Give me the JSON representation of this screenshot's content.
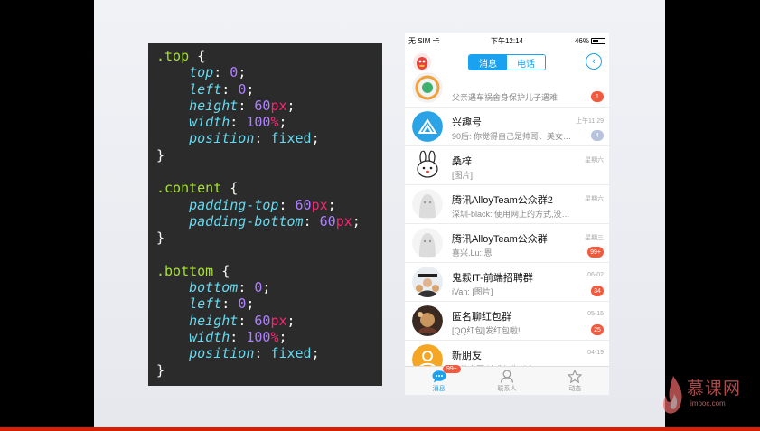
{
  "code": {
    "lines": [
      [
        {
          "t": ".top",
          "c": "sel"
        },
        {
          "t": " {",
          "c": "brace"
        }
      ],
      [
        {
          "t": "    top",
          "c": "prop"
        },
        {
          "t": ": ",
          "c": "punc"
        },
        {
          "t": "0",
          "c": "num"
        },
        {
          "t": ";",
          "c": "punc"
        }
      ],
      [
        {
          "t": "    left",
          "c": "prop"
        },
        {
          "t": ": ",
          "c": "punc"
        },
        {
          "t": "0",
          "c": "num"
        },
        {
          "t": ";",
          "c": "punc"
        }
      ],
      [
        {
          "t": "    height",
          "c": "prop"
        },
        {
          "t": ": ",
          "c": "punc"
        },
        {
          "t": "60",
          "c": "num"
        },
        {
          "t": "px",
          "c": "unit"
        },
        {
          "t": ";",
          "c": "punc"
        }
      ],
      [
        {
          "t": "    width",
          "c": "prop"
        },
        {
          "t": ": ",
          "c": "punc"
        },
        {
          "t": "100",
          "c": "num"
        },
        {
          "t": "%",
          "c": "unit"
        },
        {
          "t": ";",
          "c": "punc"
        }
      ],
      [
        {
          "t": "    position",
          "c": "prop"
        },
        {
          "t": ": ",
          "c": "punc"
        },
        {
          "t": "fixed",
          "c": "kw"
        },
        {
          "t": ";",
          "c": "punc"
        }
      ],
      [
        {
          "t": "}",
          "c": "brace"
        }
      ],
      [
        {
          "t": "",
          "c": "punc"
        }
      ],
      [
        {
          "t": ".content",
          "c": "sel"
        },
        {
          "t": " {",
          "c": "brace"
        }
      ],
      [
        {
          "t": "    padding-top",
          "c": "prop"
        },
        {
          "t": ": ",
          "c": "punc"
        },
        {
          "t": "60",
          "c": "num"
        },
        {
          "t": "px",
          "c": "unit"
        },
        {
          "t": ";",
          "c": "punc"
        }
      ],
      [
        {
          "t": "    padding-bottom",
          "c": "prop"
        },
        {
          "t": ": ",
          "c": "punc"
        },
        {
          "t": "60",
          "c": "num"
        },
        {
          "t": "px",
          "c": "unit"
        },
        {
          "t": ";",
          "c": "punc"
        }
      ],
      [
        {
          "t": "}",
          "c": "brace"
        }
      ],
      [
        {
          "t": "",
          "c": "punc"
        }
      ],
      [
        {
          "t": ".bottom",
          "c": "sel"
        },
        {
          "t": " {",
          "c": "brace"
        }
      ],
      [
        {
          "t": "    bottom",
          "c": "prop"
        },
        {
          "t": ": ",
          "c": "punc"
        },
        {
          "t": "0",
          "c": "num"
        },
        {
          "t": ";",
          "c": "punc"
        }
      ],
      [
        {
          "t": "    left",
          "c": "prop"
        },
        {
          "t": ": ",
          "c": "punc"
        },
        {
          "t": "0",
          "c": "num"
        },
        {
          "t": ";",
          "c": "punc"
        }
      ],
      [
        {
          "t": "    height",
          "c": "prop"
        },
        {
          "t": ": ",
          "c": "punc"
        },
        {
          "t": "60",
          "c": "num"
        },
        {
          "t": "px",
          "c": "unit"
        },
        {
          "t": ";",
          "c": "punc"
        }
      ],
      [
        {
          "t": "    width",
          "c": "prop"
        },
        {
          "t": ": ",
          "c": "punc"
        },
        {
          "t": "100",
          "c": "num"
        },
        {
          "t": "%",
          "c": "unit"
        },
        {
          "t": ";",
          "c": "punc"
        }
      ],
      [
        {
          "t": "    position",
          "c": "prop"
        },
        {
          "t": ": ",
          "c": "punc"
        },
        {
          "t": "fixed",
          "c": "kw"
        },
        {
          "t": ";",
          "c": "punc"
        }
      ],
      [
        {
          "t": "}",
          "c": "brace"
        }
      ]
    ]
  },
  "phone": {
    "status": {
      "carrier": "无 SIM 卡",
      "time": "下午12:14",
      "battery": "46%"
    },
    "tabs": {
      "messages": "消息",
      "calls": "电话"
    },
    "back_icon": "back-circle-icon",
    "rows": [
      {
        "name": "",
        "msg": "父亲遇车祸舍身保护儿子遇难",
        "time": "",
        "badge": "1",
        "badge_color": "red"
      },
      {
        "name": "兴趣号",
        "msg": "90后: 你觉得自己是帅哥、美女…",
        "time": "上午11:29",
        "badge": "4",
        "badge_color": "gray"
      },
      {
        "name": "桑梓",
        "msg": "[图片]",
        "time": "星期六",
        "badge": "",
        "badge_color": ""
      },
      {
        "name": "腾讯AlloyTeam公众群2",
        "msg": "深圳-black: 使用网上的方式,没…",
        "time": "星期六",
        "badge": "",
        "badge_color": ""
      },
      {
        "name": "腾讯AlloyTeam公众群",
        "msg": "喜兴.Lu: 恩",
        "time": "星期三",
        "badge": "99+",
        "badge_color": "red"
      },
      {
        "name": "鬼鬏IT-前端招聘群",
        "msg": "iVan: [图片]",
        "time": "06-02",
        "badge": "34",
        "badge_color": "red"
      },
      {
        "name": "匿名聊红包群",
        "msg": "[QQ红包]发红包啦!",
        "time": "05-15",
        "badge": "25",
        "badge_color": "red"
      },
      {
        "name": "新朋友",
        "msg": "红苹帝匪 请求加为好友",
        "time": "04-19",
        "badge": "",
        "badge_color": ""
      }
    ],
    "tabbar": {
      "messages": "消息",
      "contacts": "联系人",
      "feeds": "动态",
      "messages_badge": "99+"
    }
  },
  "watermark": {
    "name": "慕课网",
    "domain": "imooc.com"
  }
}
